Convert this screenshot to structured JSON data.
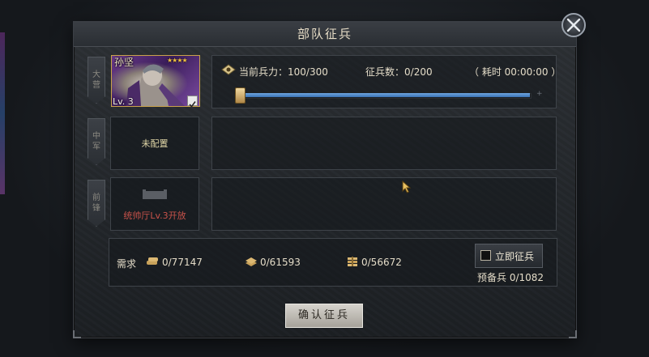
{
  "dialog": {
    "title": "部队征兵"
  },
  "slots": [
    {
      "tag": [
        "大",
        "营"
      ]
    },
    {
      "tag": [
        "中",
        "军"
      ]
    },
    {
      "tag": [
        "前",
        "锋"
      ]
    }
  ],
  "hero": {
    "name": "孙坚",
    "stars": "★★★★",
    "level": "Lv. 3"
  },
  "empty_slot": {
    "label": "未配置"
  },
  "locked_slot": {
    "label": "统帅厅Lv.3开放"
  },
  "recruit": {
    "current_label": "当前兵力：",
    "current_value": "100/300",
    "count_label": "征兵数：",
    "count_value": "0/200",
    "time": "（ 耗时 00:00:00 ）",
    "slider_value": 0,
    "slider_end": "+"
  },
  "requirements": {
    "label": "需求",
    "items": [
      {
        "icon": "wood-icon",
        "value": "0/77147"
      },
      {
        "icon": "iron-icon",
        "value": "0/61593"
      },
      {
        "icon": "grain-icon",
        "value": "0/56672"
      }
    ]
  },
  "instant": {
    "label": "立即征兵",
    "checked": false
  },
  "reserve": {
    "text": "预备兵 0/1082"
  },
  "confirm": {
    "label": "确认征兵"
  },
  "colors": {
    "accent_blue": "#4a86c8",
    "lock_red": "#c8524a",
    "gold": "#c9a24a"
  }
}
